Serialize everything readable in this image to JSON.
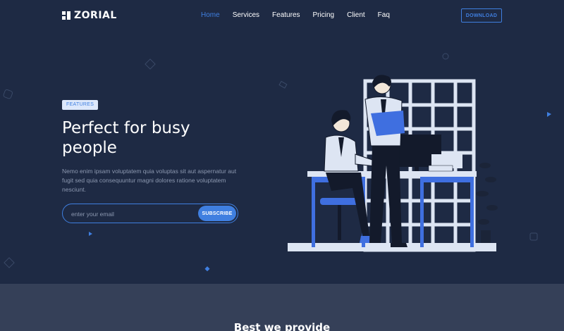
{
  "brand": {
    "name": "ZORIAL"
  },
  "nav": {
    "items": [
      {
        "label": "Home",
        "active": true
      },
      {
        "label": "Services",
        "active": false
      },
      {
        "label": "Features",
        "active": false
      },
      {
        "label": "Pricing",
        "active": false
      },
      {
        "label": "Client",
        "active": false
      },
      {
        "label": "Faq",
        "active": false
      }
    ],
    "download_label": "DOWNLOAD"
  },
  "hero": {
    "badge": "FEATURES",
    "title": "Perfect for busy people",
    "description": "Nemo enim ipsam voluptatem quia voluptas sit aut aspernatur aut fugit sed quia consequuntur magni dolores ratione voluptatem nesciunt.",
    "email_placeholder": "enter your email",
    "subscribe_label": "SUBSCRIBE"
  },
  "next_section": {
    "title": "Best we provide"
  },
  "colors": {
    "background": "#1e2a44",
    "accent": "#3f7fe0",
    "muted_text": "#8c98b0",
    "band": "#354058"
  }
}
